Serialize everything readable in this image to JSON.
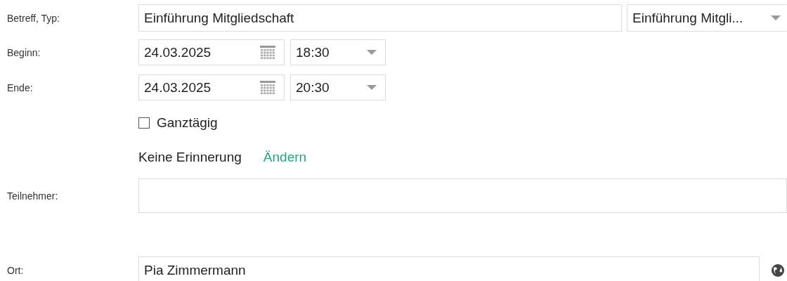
{
  "subject": {
    "label": "Betreff, Typ:",
    "value": "Einführung Mitgliedschaft",
    "type": "Einführung Mitgli..."
  },
  "begin": {
    "label": "Beginn:",
    "date": "24.03.2025",
    "time": "18:30"
  },
  "end": {
    "label": "Ende:",
    "date": "24.03.2025",
    "time": "20:30"
  },
  "all_day": {
    "label": "Ganztägig",
    "checked": false
  },
  "reminder": {
    "text": "Keine Erinnerung",
    "link": "Ändern"
  },
  "participants": {
    "label": "Teilnehmer:"
  },
  "location": {
    "label": "Ort:",
    "value": "Pia Zimmermann"
  }
}
